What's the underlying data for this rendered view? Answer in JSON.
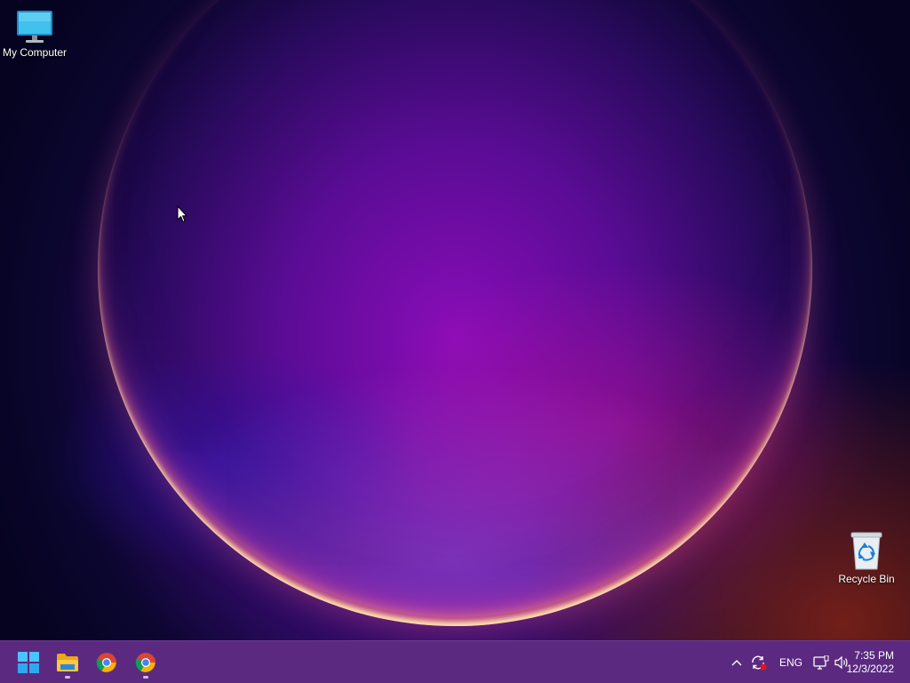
{
  "desktop": {
    "icons": [
      {
        "label": "My Computer",
        "icon": "monitor-icon"
      },
      {
        "label": "Recycle Bin",
        "icon": "recycle-bin-icon"
      }
    ]
  },
  "taskbar": {
    "apps": [
      {
        "name": "Start",
        "icon": "windows-start-icon",
        "running": false
      },
      {
        "name": "File Explorer",
        "icon": "folder-icon",
        "running": true
      },
      {
        "name": "Google Chrome",
        "icon": "chrome-icon",
        "running": false
      },
      {
        "name": "Google Chrome",
        "icon": "chrome-icon",
        "running": true
      }
    ],
    "tray": {
      "overflow_icon": "chevron-up-icon",
      "sync_icon": "sync-error-icon",
      "language": "ENG",
      "network_icon": "network-icon",
      "volume_icon": "speaker-icon"
    },
    "clock": {
      "time": "7:35 PM",
      "date": "12/3/2022"
    }
  },
  "colors": {
    "taskbar": "#5b2a80",
    "running_indicator": "#d8b7ee"
  }
}
